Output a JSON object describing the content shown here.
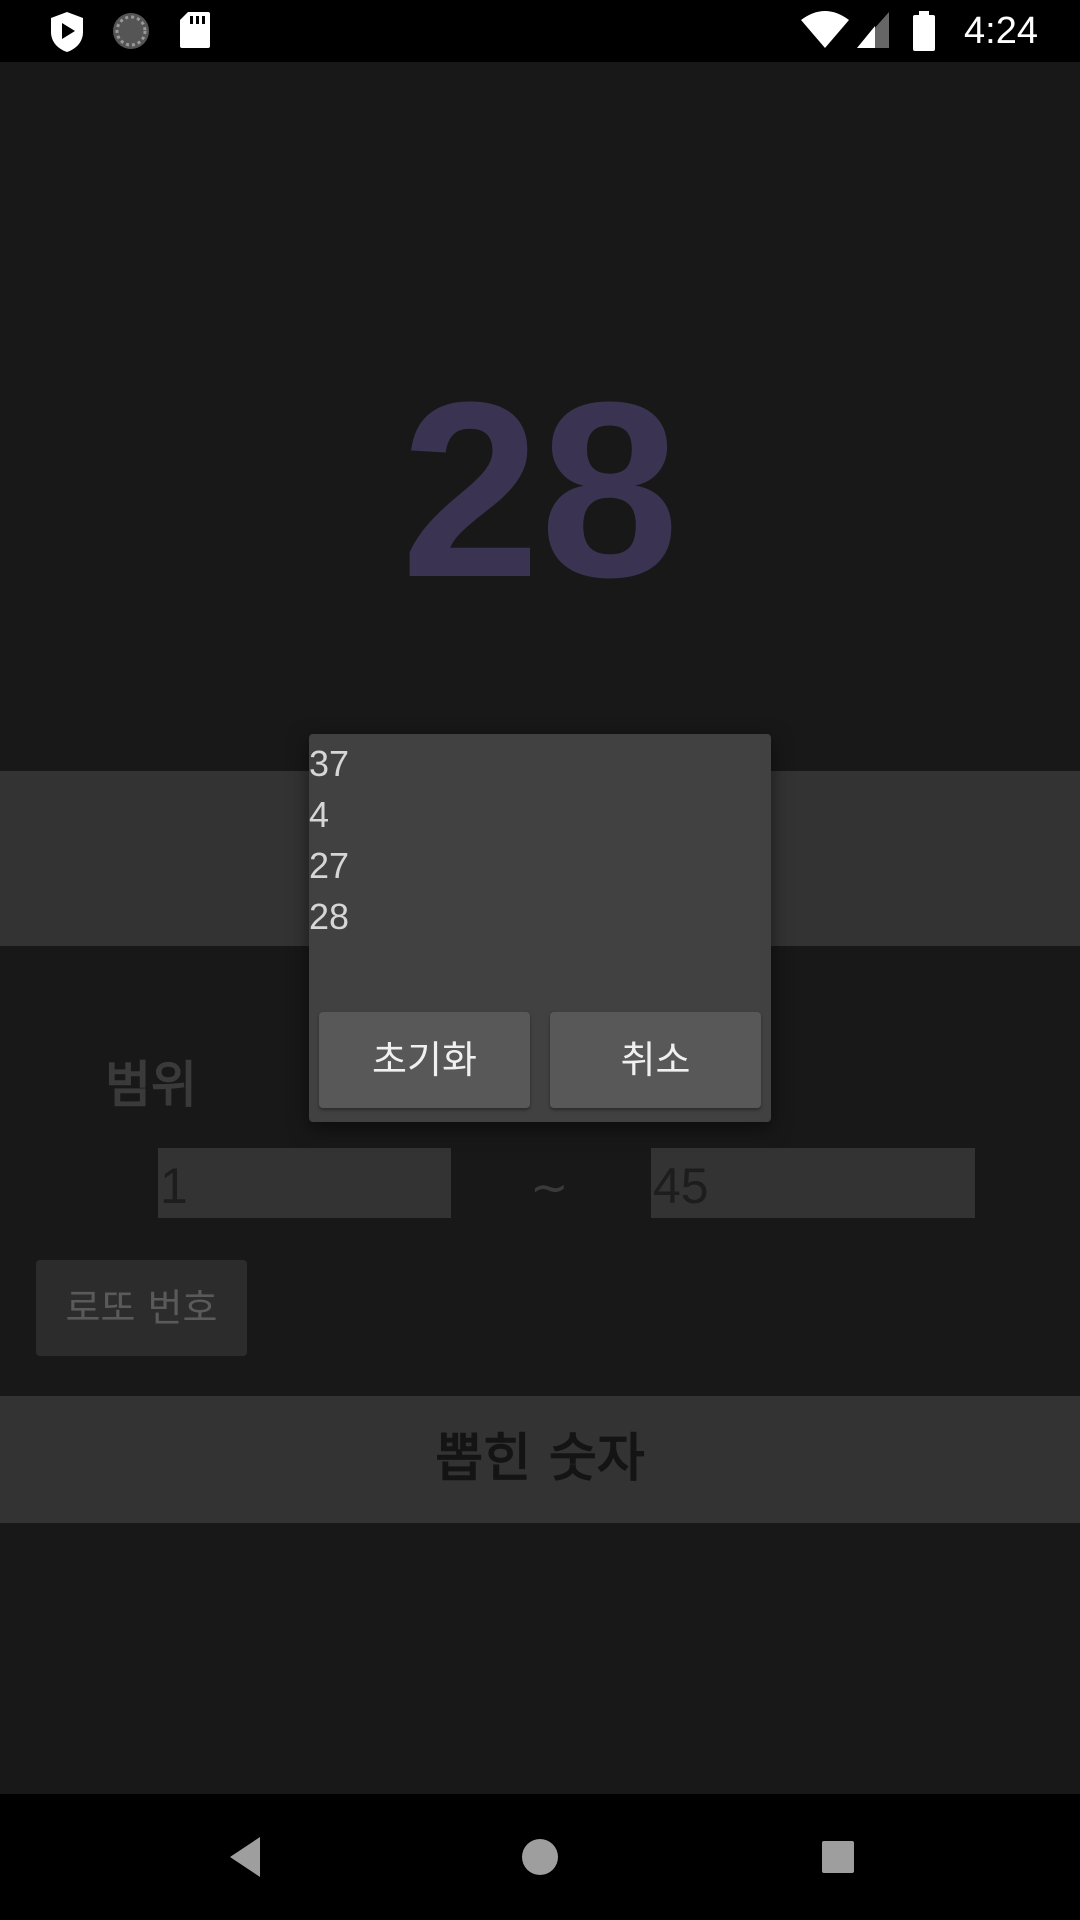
{
  "status_bar": {
    "time": "4:24",
    "icons": [
      "play-protect-icon",
      "loading-icon",
      "sd-card-icon",
      "wifi-icon",
      "cell-signal-icon",
      "battery-icon"
    ]
  },
  "main": {
    "big_number": "28",
    "range_label": "범위",
    "range_min": "1",
    "range_separator": "~",
    "range_max": "45",
    "lotto_button_label": "로또 번호",
    "drawn_numbers_label": "뽑힌 숫자"
  },
  "dialog": {
    "numbers": [
      "37",
      "4",
      "27",
      "28"
    ],
    "reset_label": "초기화",
    "cancel_label": "취소"
  },
  "nav_bar": {
    "icons": [
      "back-icon",
      "home-icon",
      "recents-icon"
    ]
  },
  "colors": {
    "big_number": "#3a3452",
    "background": "#181818",
    "dialog": "#414141",
    "dialog_button": "#585858"
  }
}
